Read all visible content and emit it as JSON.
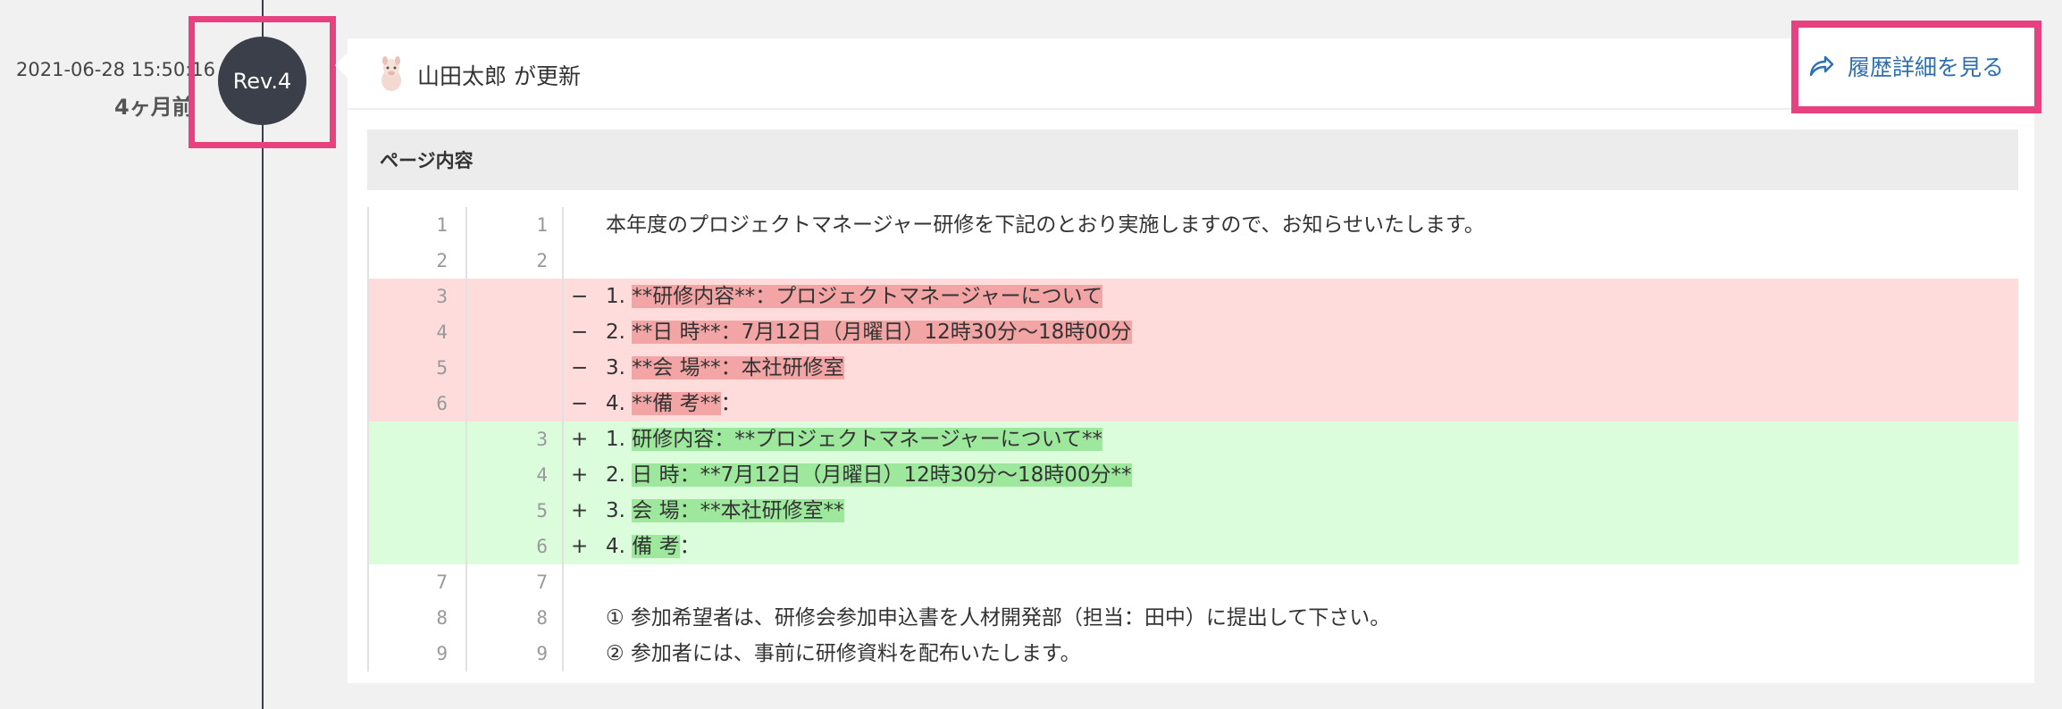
{
  "timeline": {
    "date": "2021-06-28 15:50:16",
    "ago": "4ヶ月前",
    "rev": "Rev.4"
  },
  "header": {
    "updater": "山田太郎 が更新",
    "history_label": "履歴詳細を見る"
  },
  "section": {
    "title": "ページ内容"
  },
  "diff": [
    {
      "type": "ctx",
      "old": "1",
      "new": "1",
      "sign": "",
      "pre": "本年度のプロジェクトマネージャー研修を下記のとおり実施しますので、お知らせいたします。",
      "hl": "",
      "post": ""
    },
    {
      "type": "ctx",
      "old": "2",
      "new": "2",
      "sign": "",
      "pre": "",
      "hl": "",
      "post": ""
    },
    {
      "type": "del",
      "old": "3",
      "new": "",
      "sign": "−",
      "pre": "1. ",
      "hl": "**研修内容**：プロジェクトマネージャーについて",
      "post": ""
    },
    {
      "type": "del",
      "old": "4",
      "new": "",
      "sign": "−",
      "pre": "2. ",
      "hl": "**日 時**：7月12日（月曜日）12時30分〜18時00分",
      "post": ""
    },
    {
      "type": "del",
      "old": "5",
      "new": "",
      "sign": "−",
      "pre": "3. ",
      "hl": "**会 場**：本社研修室",
      "post": ""
    },
    {
      "type": "del",
      "old": "6",
      "new": "",
      "sign": "−",
      "pre": "4. ",
      "hl": "**備 考**",
      "post": "："
    },
    {
      "type": "add",
      "old": "",
      "new": "3",
      "sign": "+",
      "pre": "1. ",
      "hl": "研修内容：**プロジェクトマネージャーについて**",
      "post": ""
    },
    {
      "type": "add",
      "old": "",
      "new": "4",
      "sign": "+",
      "pre": "2. ",
      "hl": "日 時：**7月12日（月曜日）12時30分〜18時00分**",
      "post": ""
    },
    {
      "type": "add",
      "old": "",
      "new": "5",
      "sign": "+",
      "pre": "3. ",
      "hl": "会 場：**本社研修室**",
      "post": ""
    },
    {
      "type": "add",
      "old": "",
      "new": "6",
      "sign": "+",
      "pre": "4. ",
      "hl": "備 考",
      "post": "："
    },
    {
      "type": "ctx",
      "old": "7",
      "new": "7",
      "sign": "",
      "pre": "",
      "hl": "",
      "post": ""
    },
    {
      "type": "ctx",
      "old": "8",
      "new": "8",
      "sign": "",
      "pre": "① 参加希望者は、研修会参加申込書を人材開発部（担当：田中）に提出して下さい。",
      "hl": "",
      "post": ""
    },
    {
      "type": "ctx",
      "old": "9",
      "new": "9",
      "sign": "",
      "pre": "② 参加者には、事前に研修資料を配布いたします。",
      "hl": "",
      "post": ""
    }
  ]
}
